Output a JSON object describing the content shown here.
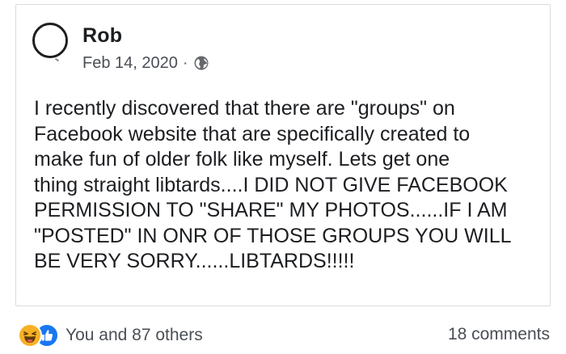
{
  "post": {
    "author": "Rob",
    "date": "Feb 14, 2020",
    "separator": "·",
    "privacy_icon": "globe-icon",
    "text": "I recently discovered that there are \"groups\" on\nFacebook website that are specifically created to\nmake fun of older folk like myself. Lets get one\nthing straight libtards....I DID NOT GIVE FACEBOOK\nPERMISSION TO \"SHARE\" MY PHOTOS......IF I AM\n\"POSTED\" IN ONR OF THOSE GROUPS YOU WILL\nBE VERY SORRY......LIBTARDS!!!!!"
  },
  "footer": {
    "reaction_icons": [
      "haha-reaction-icon",
      "like-reaction-icon"
    ],
    "reactions_label": "You and 87 others",
    "comments_label": "18 comments"
  },
  "colors": {
    "text": "#1c1e21",
    "secondary_text": "#4b4f56",
    "like_blue": "#1877f2",
    "haha_yellow": "#f7b125",
    "card_border": "#d9dbe0"
  }
}
